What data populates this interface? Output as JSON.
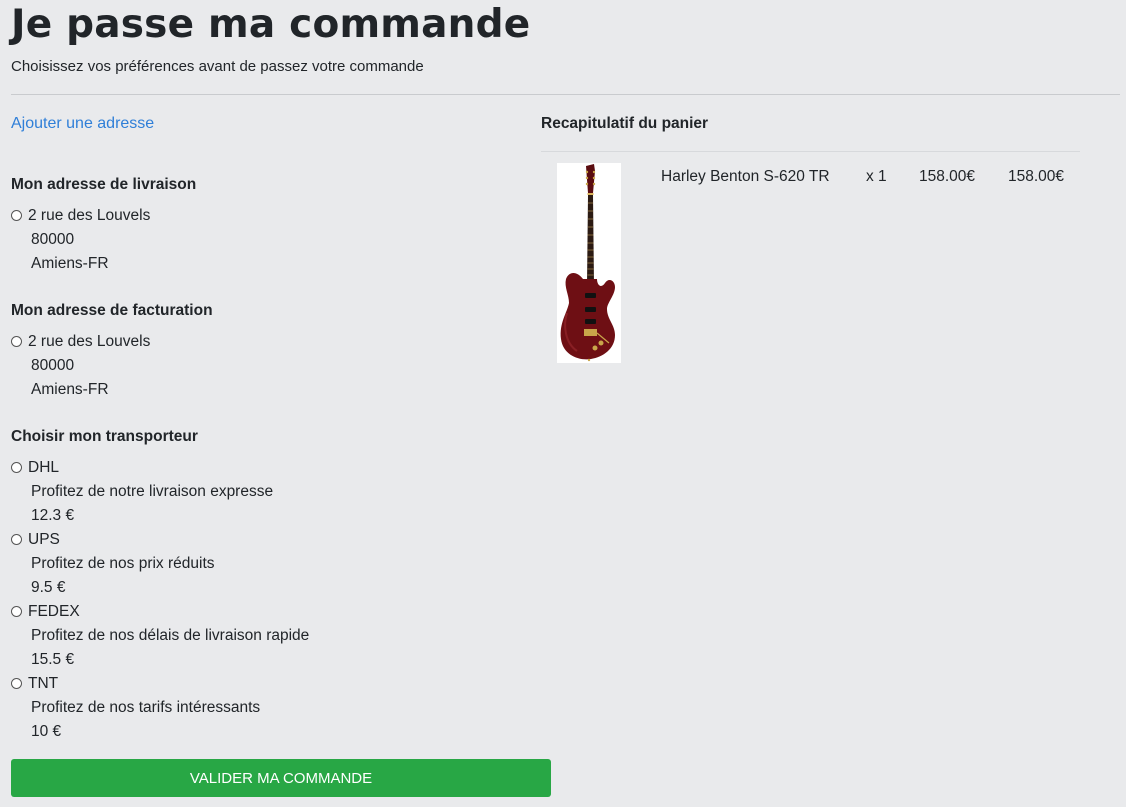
{
  "page": {
    "title": "Je passe ma commande",
    "subtitle": "Choisissez vos préférences avant de passez votre commande"
  },
  "add_address_link": "Ajouter une adresse",
  "delivery_address": {
    "heading": "Mon adresse de livraison",
    "street": "2 rue des Louvels",
    "postcode": "80000",
    "city": "Amiens-FR"
  },
  "billing_address": {
    "heading": "Mon adresse de facturation",
    "street": "2 rue des Louvels",
    "postcode": "80000",
    "city": "Amiens-FR"
  },
  "carriers": {
    "heading": "Choisir mon transporteur",
    "items": [
      {
        "name": "DHL",
        "description": "Profitez de notre livraison expresse",
        "price": "12.3 €"
      },
      {
        "name": "UPS",
        "description": "Profitez de nos prix réduits",
        "price": "9.5 €"
      },
      {
        "name": "FEDEX",
        "description": "Profitez de nos délais de livraison rapide",
        "price": "15.5 €"
      },
      {
        "name": "TNT",
        "description": "Profitez de nos tarifs intéressants",
        "price": "10 €"
      }
    ]
  },
  "submit_button": "VALIDER MA COMMANDE",
  "cart": {
    "heading": "Recapitulatif du panier",
    "items": [
      {
        "name": "Harley Benton S-620 TR",
        "quantity": "x 1",
        "unit_price": "158.00€",
        "total": "158.00€",
        "image_icon": "electric-guitar-image"
      }
    ]
  },
  "colors": {
    "background": "#e9eaec",
    "link": "#2f7fd8",
    "button": "#28a745",
    "guitar_body": "#6e0f14"
  }
}
